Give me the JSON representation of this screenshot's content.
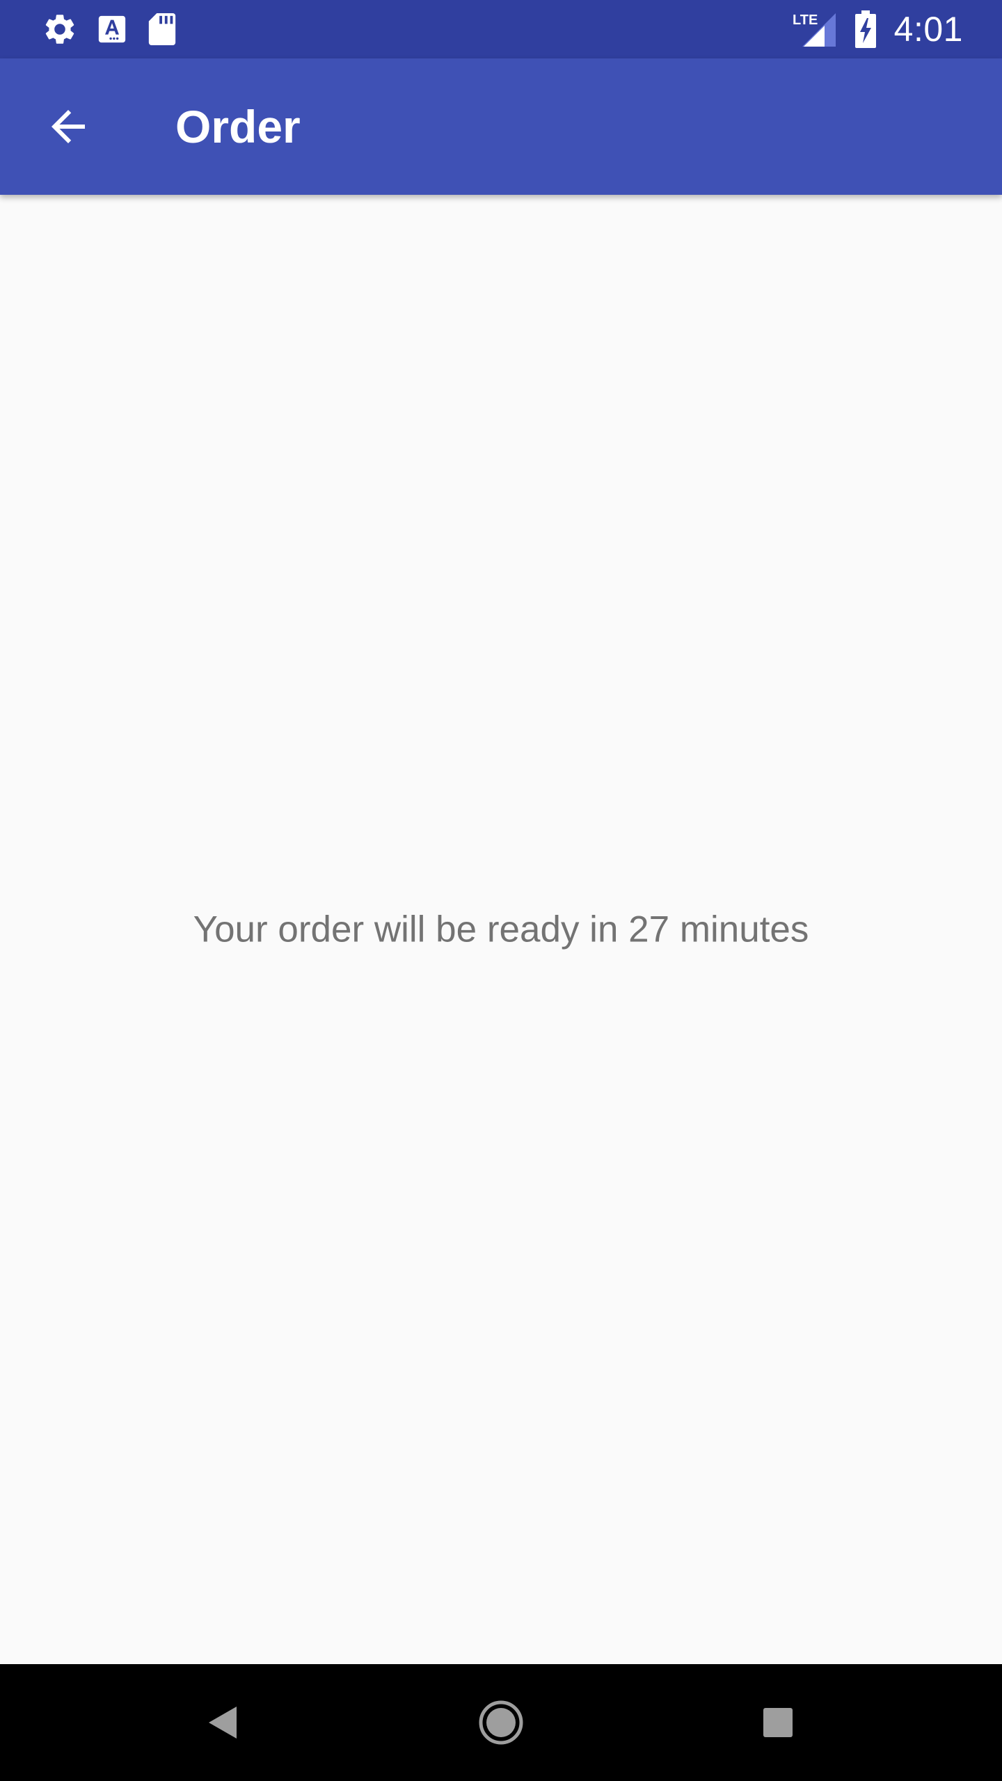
{
  "status_bar": {
    "time": "4:01",
    "network_label": "LTE",
    "left_icons": [
      "gear-icon",
      "text-a-icon",
      "sd-card-icon"
    ],
    "right_icons": [
      "signal-icon",
      "battery-charging-icon"
    ],
    "background": "#303f9f"
  },
  "app_bar": {
    "title": "Order",
    "back_icon": "arrow-back-icon",
    "background": "#3f51b5"
  },
  "content": {
    "message": "Your order will be ready in 27 minutes"
  },
  "nav_bar": {
    "buttons": [
      "back-triangle-icon",
      "home-circle-icon",
      "recents-square-icon"
    ]
  }
}
